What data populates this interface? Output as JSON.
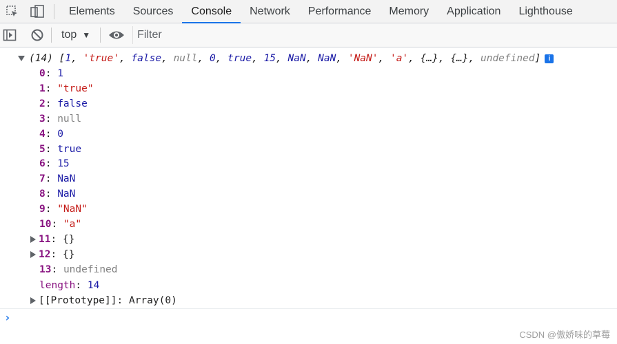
{
  "tabs": [
    "Elements",
    "Sources",
    "Console",
    "Network",
    "Performance",
    "Memory",
    "Application",
    "Lighthouse"
  ],
  "active_tab": "Console",
  "toolbar": {
    "context": "top",
    "filter_placeholder": "Filter"
  },
  "console": {
    "summary_count": "(14)",
    "summary": [
      {
        "text": "[",
        "cls": "plain"
      },
      {
        "text": "1",
        "cls": "num"
      },
      {
        "text": ", ",
        "cls": "plain"
      },
      {
        "text": "'true'",
        "cls": "str"
      },
      {
        "text": ", ",
        "cls": "plain"
      },
      {
        "text": "false",
        "cls": "bool"
      },
      {
        "text": ", ",
        "cls": "plain"
      },
      {
        "text": "null",
        "cls": "nul"
      },
      {
        "text": ", ",
        "cls": "plain"
      },
      {
        "text": "0",
        "cls": "num"
      },
      {
        "text": ", ",
        "cls": "plain"
      },
      {
        "text": "true",
        "cls": "bool"
      },
      {
        "text": ", ",
        "cls": "plain"
      },
      {
        "text": "15",
        "cls": "num"
      },
      {
        "text": ", ",
        "cls": "plain"
      },
      {
        "text": "NaN",
        "cls": "num"
      },
      {
        "text": ", ",
        "cls": "plain"
      },
      {
        "text": "NaN",
        "cls": "num"
      },
      {
        "text": ", ",
        "cls": "plain"
      },
      {
        "text": "'NaN'",
        "cls": "str"
      },
      {
        "text": ", ",
        "cls": "plain"
      },
      {
        "text": "'a'",
        "cls": "str"
      },
      {
        "text": ", ",
        "cls": "plain"
      },
      {
        "text": "{…}",
        "cls": "plain"
      },
      {
        "text": ", ",
        "cls": "plain"
      },
      {
        "text": "{…}",
        "cls": "plain"
      },
      {
        "text": ", ",
        "cls": "plain"
      },
      {
        "text": "undefined",
        "cls": "und"
      },
      {
        "text": "]",
        "cls": "plain"
      }
    ],
    "entries": [
      {
        "key": "0",
        "value": "1",
        "cls": "num"
      },
      {
        "key": "1",
        "value": "\"true\"",
        "cls": "str"
      },
      {
        "key": "2",
        "value": "false",
        "cls": "bool"
      },
      {
        "key": "3",
        "value": "null",
        "cls": "nul"
      },
      {
        "key": "4",
        "value": "0",
        "cls": "num"
      },
      {
        "key": "5",
        "value": "true",
        "cls": "bool"
      },
      {
        "key": "6",
        "value": "15",
        "cls": "num"
      },
      {
        "key": "7",
        "value": "NaN",
        "cls": "num"
      },
      {
        "key": "8",
        "value": "NaN",
        "cls": "num"
      },
      {
        "key": "9",
        "value": "\"NaN\"",
        "cls": "str"
      },
      {
        "key": "10",
        "value": "\"a\"",
        "cls": "str"
      },
      {
        "key": "11",
        "value": "{}",
        "cls": "plain",
        "expandable": true
      },
      {
        "key": "12",
        "value": "{}",
        "cls": "plain",
        "expandable": true
      },
      {
        "key": "13",
        "value": "undefined",
        "cls": "und"
      }
    ],
    "length_key": "length",
    "length_value": "14",
    "prototype_key": "[[Prototype]]",
    "prototype_value": "Array(0)",
    "prompt": "›"
  },
  "watermark": "CSDN @傲娇味的草莓",
  "colors": {
    "accent": "#1a73e8",
    "key": "#881280",
    "string": "#c41a16",
    "number": "#1a1aa6",
    "null": "#808080"
  },
  "icons": [
    "inspect-element-icon",
    "device-toggle-icon",
    "sidebar-toggle-icon",
    "clear-console-icon",
    "eye-icon",
    "info-icon",
    "expand-arrow-icon"
  ]
}
